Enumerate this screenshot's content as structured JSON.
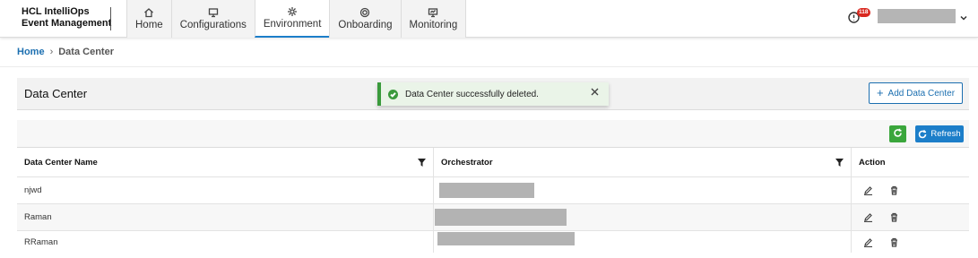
{
  "header": {
    "brand_line1": "HCL IntelliOps",
    "brand_line2": "Event Management",
    "nav": [
      {
        "label": "Home",
        "icon": "home-icon"
      },
      {
        "label": "Configurations",
        "icon": "configurations-icon"
      },
      {
        "label": "Environment",
        "icon": "environment-icon",
        "active": true
      },
      {
        "label": "Onboarding",
        "icon": "onboarding-icon"
      },
      {
        "label": "Monitoring",
        "icon": "monitoring-icon"
      }
    ],
    "notification_count": "118"
  },
  "breadcrumb": {
    "home": "Home",
    "current": "Data Center"
  },
  "page": {
    "title": "Data Center",
    "add_button": "Add Data Center",
    "refresh_button": "Refresh"
  },
  "toast": {
    "message": "Data Center successfully deleted.",
    "color": "#3a9a3c"
  },
  "table": {
    "columns": [
      "Data Center Name",
      "Orchestrator",
      "Action"
    ],
    "rows": [
      {
        "name": "njwd"
      },
      {
        "name": "Raman"
      },
      {
        "name": "RRaman"
      }
    ]
  },
  "colors": {
    "primary": "#1c7ec9",
    "success": "#3aa63c",
    "badge": "#d9281f"
  }
}
